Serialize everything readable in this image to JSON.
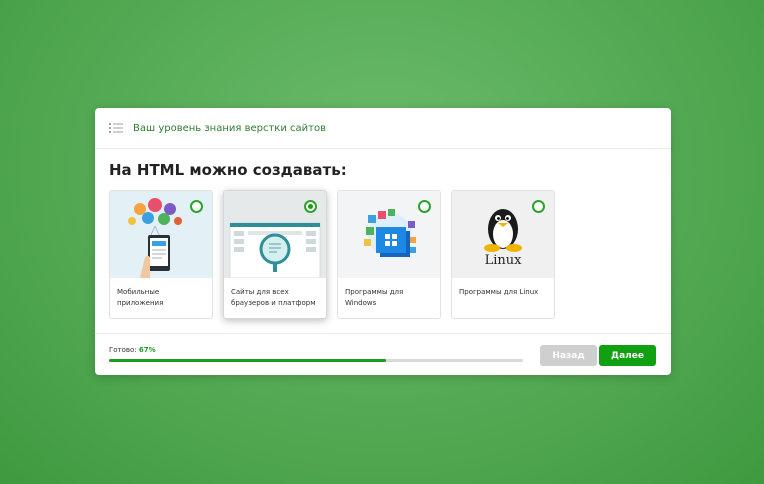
{
  "header": {
    "title": "Ваш уровень знания верстки сайтов"
  },
  "question": "На HTML можно создавать:",
  "options": [
    {
      "label": "Мобильные приложения",
      "selected": false
    },
    {
      "label": "Сайты для всех браузеров и платформ",
      "selected": true
    },
    {
      "label": "Программы для Windows",
      "selected": false
    },
    {
      "label": "Программы для Linux",
      "selected": false
    }
  ],
  "linux_logo_text": "Linux",
  "progress": {
    "label": "Готово:",
    "value_text": "67%",
    "fraction": 0.67
  },
  "buttons": {
    "back": "Назад",
    "next": "Далее"
  },
  "colors": {
    "accent": "#11a011",
    "disabled": "#cfcfcf",
    "background": "#58ad58"
  }
}
